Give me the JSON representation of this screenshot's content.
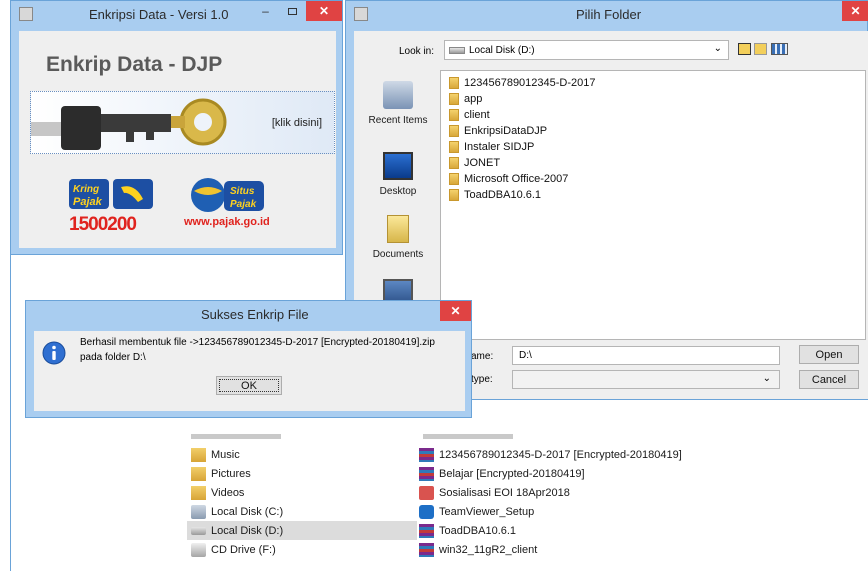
{
  "explorer": {
    "nav_items": [
      {
        "label": "Music",
        "icon": "music-folder-icon"
      },
      {
        "label": "Pictures",
        "icon": "pictures-folder-icon"
      },
      {
        "label": "Videos",
        "icon": "videos-folder-icon"
      },
      {
        "label": "Local Disk (C:)",
        "icon": "drive-icon"
      },
      {
        "label": "Local Disk (D:)",
        "icon": "drive-icon"
      },
      {
        "label": "CD Drive (F:)",
        "icon": "cd-drive-icon"
      }
    ],
    "files": [
      {
        "label": "123456789012345-D-2017 [Encrypted-20180419]",
        "icon": "archive-icon"
      },
      {
        "label": "Belajar [Encrypted-20180419]",
        "icon": "archive-icon"
      },
      {
        "label": "Sosialisasi EOI 18Apr2018",
        "icon": "powerpoint-icon"
      },
      {
        "label": "TeamViewer_Setup",
        "icon": "teamviewer-icon"
      },
      {
        "label": "ToadDBA10.6.1",
        "icon": "archive-icon"
      },
      {
        "label": "win32_11gR2_client",
        "icon": "archive-icon"
      }
    ]
  },
  "enkrip": {
    "title": "Enkripsi Data - Versi 1.0",
    "heading": "Enkrip Data - DJP",
    "banner_link": "[klik disini]",
    "kring_pajak_number": "1500200",
    "kring_pajak_logo_text": "Kring Pajak",
    "situs_pajak_logo_text": "Situs Pajak",
    "situs_url": "www.pajak.go.id"
  },
  "pilih": {
    "title": "Pilih Folder",
    "look_in_label": "Look in:",
    "look_in_value": "Local Disk (D:)",
    "places": [
      "Recent Items",
      "Desktop",
      "Documents"
    ],
    "folders": [
      "123456789012345-D-2017",
      "app",
      "client",
      "EnkripsiDataDJP",
      "Instaler SIDJP",
      "JONET",
      "Microsoft Office-2007",
      "ToadDBA10.6.1"
    ],
    "name_label": "ame:",
    "name_value": "D:\\",
    "type_label": "type:",
    "type_value": "",
    "open_label": "Open",
    "cancel_label": "Cancel"
  },
  "sukses": {
    "title": "Sukses Enkrip File",
    "message_line1": "Berhasil membentuk file ->123456789012345-D-2017 [Encrypted-20180419].zip",
    "message_line2": "pada folder D:\\",
    "ok_label": "OK"
  }
}
